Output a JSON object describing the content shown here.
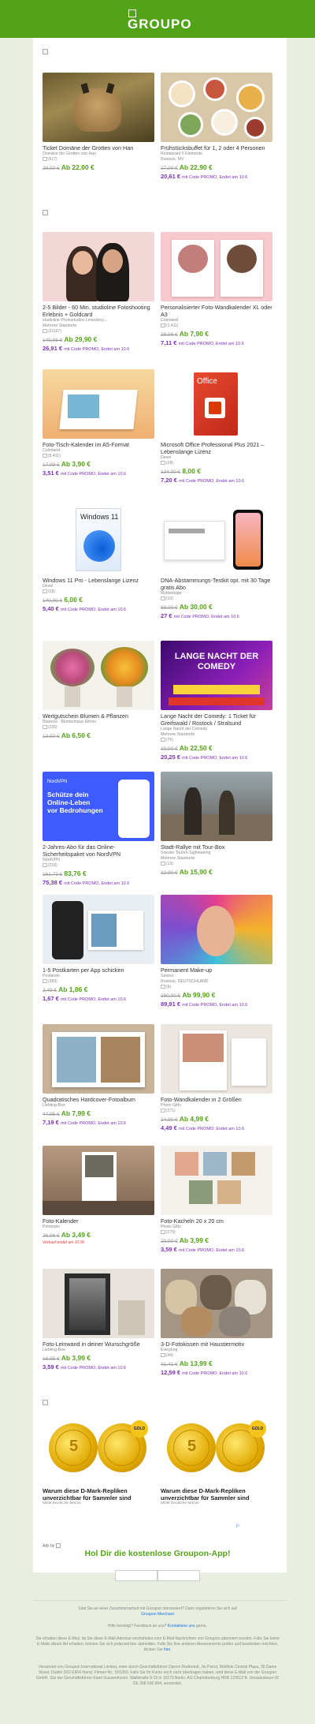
{
  "brand": {
    "logo_text": "GROUPO",
    "accent": "#53a318",
    "promo_color": "#7b2fbe"
  },
  "deals": [
    {
      "title": "Ticket Domäne der Grotten von Han",
      "sub": "Domäne der Grotten von Han",
      "rating": "(517)",
      "old": "29,00 €",
      "new": "Ab 22,00 €",
      "promo": ""
    },
    {
      "title": "Frühstücksbuffet für 1, 2 oder 4 Personen",
      "sub": "Restaurant 5 Elements",
      "sub2": "Rostock, MV",
      "rating": "",
      "old": "27,00 €",
      "new": "Ab 22,90 €",
      "promo_price": "20,61 €",
      "promo_text": "mit Code PROMO, Endet am 10.6"
    },
    {
      "title": "2-5 Bilder - 60 Min. studioline Fotoshooting Erlebnis + Goldcard",
      "sub": "studioline Photostudios Leverdory...",
      "sub2": "Mehrere Standorte",
      "rating": "(21167)",
      "old": "149,98 €",
      "new": "Ab 29,90 €",
      "promo_price": "26,91 €",
      "promo_text": "mit Code PROMO, Endet am 10.6"
    },
    {
      "title": "Personalisierter Foto-Wandkalender XL oder A3",
      "sub": "Colorland",
      "rating": "(1.411)",
      "old": "29,99 €",
      "new": "Ab 7,90 €",
      "promo_price": "7,11 €",
      "promo_text": "mit Code PROMO, Endet am 10.6"
    },
    {
      "title": "Foto-Tisch-Kalender im A5-Format",
      "sub": "Colorland",
      "rating": "(5.431)",
      "old": "17,99 €",
      "new": "Ab 3,90 €",
      "promo_price": "3,51 €",
      "promo_text": "mit Code PROMO, Endet am 10.6"
    },
    {
      "title": "Microsoft Office Professional Plus 2021 – Lebenslange Lizenz",
      "sub": "Dexel",
      "rating": "(28)",
      "old": "134,00 €",
      "new": "8,00 €",
      "promo_price": "7,20 €",
      "promo_text": "mit Code PROMO, Endet am 10.6"
    },
    {
      "title": "Windows 11 Pro - Lebenslange Lizenz",
      "sub": "Dexel",
      "rating": "(28)",
      "old": "140,00 €",
      "new": "6,00 €",
      "promo_price": "5,40 €",
      "promo_text": "mit Code PROMO, Endet am 10.6"
    },
    {
      "title": "DNA-Abstammungs-Testkit opt. mit 30 Tage gratis Abo",
      "sub": "MyHeritage",
      "rating": "(10)",
      "old": "89,00 €",
      "new": "Ab 30,00 €",
      "promo_price": "27 €",
      "promo_text": "mit Code PROMO, Endet am 10.6"
    },
    {
      "title": "Wertgutschein Blumen & Pflanzen",
      "sub": "Blueeza - Blumenhaus Ellmer",
      "rating": "(226)",
      "old": "13,00 €",
      "new": "Ab 6,50 €",
      "promo": ""
    },
    {
      "title": "Lange Nacht der Comedy: 1 Ticket für Greifswald / Rostock / Stralsund",
      "sub": "Lange Nacht der Comedy",
      "sub2": "Mehrere Standorte",
      "rating": "(75)",
      "old": "30,00 €",
      "new": "Ab 22,50 €",
      "promo_price": "20,25 €",
      "promo_text": "mit Code PROMO, Endet am 10.6"
    },
    {
      "title": "2-Jahres-Abo für das Online-Sicherheitspaket von NordVPN",
      "sub": "NordVPN",
      "rating": "(218)",
      "old": "161,73 €",
      "new": "83,76 €",
      "promo_price": "75,38 €",
      "promo_text": "mit Code PROMO, Endet am 10.6"
    },
    {
      "title": "Stadt-Rallye mit Tour-Box",
      "sub": "Sokoke Touren-Sightseeing",
      "sub2": "Mehrere Standorte",
      "rating": "(13)",
      "old": "22,90 €",
      "new": "Ab 15,90 €",
      "promo": ""
    },
    {
      "title": "1-5 Postkarten per App schicken",
      "sub": "Postando",
      "rating": "(383)",
      "old": "2,49 €",
      "new": "Ab 1,86 €",
      "promo_price": "1,67 €",
      "promo_text": "mit Code PROMO, Endet am 10.6"
    },
    {
      "title": "Permanent Make-up",
      "sub": "Selena",
      "sub2": "Rostock, DEUTSCHLAND",
      "rating": "(9)",
      "old": "280,00 €",
      "new": "Ab 99,90 €",
      "promo_price": "89,91 €",
      "promo_text": "mit Code PROMO, Endet am 10.6"
    },
    {
      "title": "Quadratisches Hardcover-Fotoalbum",
      "sub": "Liebling-Boo",
      "rating": "",
      "old": "44,95 €",
      "new": "Ab 7,99 €",
      "promo_price": "7,19 €",
      "promo_text": "mit Code PROMO, Endet am 10.6"
    },
    {
      "title": "Foto-Wandkalender in 2 Größen",
      "sub": "Photo Gifts",
      "rating": "(271)",
      "old": "24,90 €",
      "new": "Ab 4,99 €",
      "promo_price": "4,49 €",
      "promo_text": "mit Code PROMO, Endet am 10.6"
    },
    {
      "title": "Foto-Kalender",
      "sub": "Printerpix",
      "rating": "",
      "old": "26,96 €",
      "new": "Ab 3,49 €",
      "note": "Verkauf endet am 10.06"
    },
    {
      "title": "Foto-Kacheln 20 x 20 cm",
      "sub": "Photo Gifts",
      "rating": "(279)",
      "old": "20,00 €",
      "new": "Ab 3,99 €",
      "promo_price": "3,59 €",
      "promo_text": "mit Code PROMO, Endet am 10.6"
    },
    {
      "title": "Foto-Leinwand in deiner Wunschgröße",
      "sub": "Liebling-Boo",
      "rating": "",
      "old": "16,95 €",
      "new": "Ab 3,99 €",
      "promo_price": "3,59 €",
      "promo_text": "mit Code PROMO, Endet am 10.6"
    },
    {
      "title": "3-D-Fotokissen mit Haustiermotiv",
      "sub": "Everyling",
      "rating": "(44)",
      "old": "41,41 €",
      "new": "Ab 13,99 €",
      "promo_price": "12,59 €",
      "promo_text": "mit Code PROMO, Endet am 10.6"
    }
  ],
  "ads": [
    {
      "title": "Warum diese D-Mark-Repliken unverzichtbar für Sammler sind",
      "src": "MDM Deutsche Münze",
      "badge": "GOLD"
    },
    {
      "title": "Warum diese D-Mark-Repliken unverzichtbar für Sammler sind",
      "src": "MDM Deutsche Münze",
      "badge": "GOLD"
    }
  ],
  "ads_label": "Ads by",
  "app_cta": "Hol Dir die kostenlose Groupon-App!",
  "footer": {
    "line1": "Sind Sie an einer Zusammenarbeit mit Groupon interessiert? Dann registrieren Sie sich auf",
    "link1": "Groupon Merchant",
    "line2_pre": "Hilfe benötigt? Feedback an uns?",
    "link2": "Kontaktiere uns",
    "line2_post": "gerne.",
    "line3": "Sie erhalten diese E-Mail, da Sie diese E-Mail-Adresse verdrahtaler.com E-Mail-Nachrichten von Groupon abonniert worden. Falls Sie keine E-Mails dieser Art erhalten, können Sie sich jederzeit hier abmelden. Falls Sie Ihre anderen Abonnements prüfen und bearbeiten möchten, klicken Sie",
    "link3": "hier",
    "line4": "Versendet von Groupon International Limited, einer durch Geschäftsführer Darren Redmond, Jin Poirot, Wellfork Central Plaza, 36 Dame Street, Dublin D02 E964 Irland, Firmen-Nr.: 501350. Falls Sie Ihr Konto noch nicht übertragen haben, wird diese E-Mail von der Groupon GmbH, Sitz der Geschäftsführer Karel Gussenhoven, Wallstraße 9-13 in 10179 Berlin, AG Charlottenburg HRB 123512 B, Umsatzsteuer-ID DE 268 590 854, versendet."
  }
}
